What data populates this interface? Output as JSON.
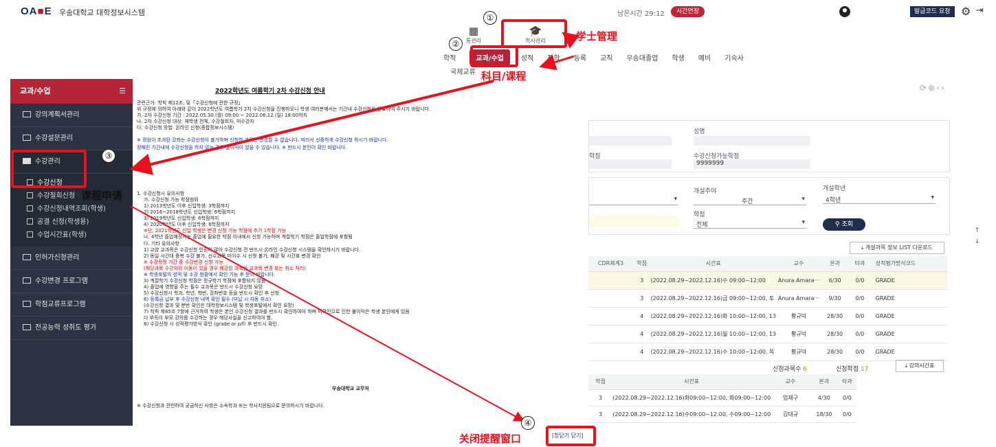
{
  "header": {
    "logo_a": "OA",
    "logo_b": "E",
    "system_name": "우송대학교 대학정보시스템",
    "remaining_time": "남은시간 29:12",
    "extend_label": "시간연장",
    "code_request_label": "발급코드 요청",
    "icons": [
      "user-icon",
      "gear-icon",
      "logout-icon"
    ]
  },
  "menu": {
    "icon_left_label": "통관리",
    "icon_active_label": "학사관리",
    "tabs": [
      "학적",
      "교과/수업",
      "성적",
      "장학",
      "등록",
      "교직",
      "우송대졸업",
      "학생",
      "예비",
      "기숙사"
    ],
    "active_tab": "교과/수업",
    "sub_tab": "국제교류"
  },
  "sidebar": {
    "title": "교과/수업",
    "items": [
      {
        "label": "강의계획서관리"
      },
      {
        "label": "수강설문관리"
      },
      {
        "label": "수강관리"
      },
      {
        "label": "인허가신청관리"
      },
      {
        "label": "수강변경 프로그램"
      },
      {
        "label": "학점교류프로그램"
      },
      {
        "label": "전공능력 성취도 평가"
      }
    ],
    "sub_items": [
      "수강신청",
      "수강철회신청",
      "수강신청내역조회(학생)",
      "공결 신청(학생용)",
      "수업시간표(학생)"
    ]
  },
  "notice": {
    "title": "2022학년도 여름학기 2차 수강신청 안내",
    "lines": [
      "관련근거: 학칙 제12조, 및「수강신청에 관한 규정」",
      "위 규정에 의하여 아래와 같이 2022학년도 여름학기 2차 수강신청을 진행하오니 학생 여러분께서는 기간내 수강신청을 완료하여 주시기 바랍니다.",
      "가. 2차 수강신청 기간 : 2022.05.30.(월) 09:00 ~ 2022.06.12.(일) 18:00까지",
      "나. 2차 수강신청 대상: 재학생 전체, 수강철회자, 미수강자",
      "다. 수강신청 방법: 온라인 신청(종합정보시스템)",
      "※ 정원이 초과된 강좌는 수강신청이 불가하며 신청한 과목은 변경할 수 없습니다. 따라서 신중하게 수강신청 하시기 바랍니다.",
      "정해진 기간내에 수강신청을 하지 않는 경우 불이익이 있을 수 있습니다. ※ 반드시 본인이 확인 바랍니다.",
      "1. 수강신청시 유의사항",
      "가. 수강신청 가능 학점범위",
      "1) 2013학년도 이후 신입학생: 3학점까지",
      "2) 2016~2018학년도 신입학생: 6학점까지",
      "3) 2019학년도 신입학생: 6학점까지",
      "4) 2020학년도 이후 신입학생: 6학점까지",
      "※단, 2021학년도 신입 학생은 변경 신청 가능 학점에 추가 1학점 가능",
      "나. 4학년 졸업예정자는 졸업에 필요한 학점 이내에서 신청 가능하며 계절학기 학점은 졸업학점에 포함됨",
      "다. 기타 유의사항",
      "1) 교양 교과목은 수강신청 인원이 많아 수강신청 전 반드시 온라인 수강신청 시스템을 확인하시기 바랍니다.",
      "2) 동일 시간대 중복 수강 불가, 선수과목 미이수 시 신청 불가, 폐강 및 시간표 변경 확인",
      "※ 수강정정 기간 중 수강변경 신청 가능",
      "(해당과목 수강자의 이동이 있을 경우 폐강된 과목은 교과목 변경 또는 취소 처리)",
      "※ 학생포털의 성적 및 수강 현황에서 확인 가능 후 문의 바랍니다.",
      "3) 계절학기 수강신청 학점은 정규학기 학점에 포함되지 않음",
      "4) 졸업에 영향을 주는 필수 교과목은 반드시 수강신청 요망",
      "5) 수강신청시 학과, 학년, 학번, 강좌번호 등을 반드시 확인 후 신청",
      "6) 등록금 납부 후 수강신청 내역 확인 필수 (미납 시 자동 취소)",
      "(수강신청 결과 및 분반 확인은 대학정보시스템 및 학생포털에서 확인 요망)",
      "7) 학칙 제85조 7항에 근거하여 학생은 본인 수강신청 결과를 반드시 확인하여야 하며 미확인으로 인한 불이익은 학생 본인에게 있음",
      "다 부득이 부모 강의를 수강하는 경우 해당사실을 신고하여야 함.",
      "8) 수강신청 시 성적평가방식 확인 (grade or p/f) 후 반드시 확인."
    ],
    "footer_org": "우송대학교 교무처",
    "footer_note": "※ 수강신청과 관련하여 궁금하신 사항은 소속학과 또는 학사지원팀으로 문의하시기 바랍니다.",
    "close_label": "[창닫기 닫기]"
  },
  "student_info": {
    "name_label": "성명",
    "credit_label": "학점",
    "avail_label": "수강신청가능학점",
    "avail_value": "9999999"
  },
  "filters": {
    "week_label": "개설주야",
    "week_value": "주간",
    "grade_label": "개설학년",
    "grade_value": "4학년",
    "credit_label": "학점",
    "credit_value": "전체",
    "search_label": "조회"
  },
  "course_table": {
    "download_label": "개설과목 정보 LIST 다운로드",
    "headers": [
      "CDR체계3",
      "학점",
      "시간표",
      "교수",
      "본과",
      "타과",
      "성적평가방식코드"
    ],
    "rows": [
      [
        "",
        "3",
        "(2022.08.29~2022.12.16)수 09:00~12:00",
        "Anura Amara···",
        "6/30",
        "0/0",
        "GRADE"
      ],
      [
        "",
        "3",
        "(2022.08.29~2022.12.16)금 09:00~12:00, 토",
        "Anura Amara···",
        "9/30",
        "0/0",
        "GRADE"
      ],
      [
        "",
        "4",
        "(2022.08.29~2022.12.16)화 10:00~12:00, 13",
        "황규덕",
        "28/30",
        "0/0",
        "GRADE"
      ],
      [
        "",
        "4",
        "(2022.08.29~2022.12.16)월 10:00~12:00, 13",
        "황규덕",
        "28/30",
        "0/0",
        "GRADE"
      ],
      [
        "",
        "4",
        "(2022.08.29~2022.12.16)수 10:00~12:00, 목",
        "황규덕",
        "28/30",
        "0/0",
        "GRADE"
      ]
    ]
  },
  "applied": {
    "count_label": "신청과목수",
    "count_value": "6",
    "credit_label": "신청학점",
    "credit_value": "17",
    "timetable_label": "강의시간표",
    "headers": [
      "학점",
      "시간표",
      "교수",
      "본과",
      "타과"
    ],
    "rows": [
      [
        "3",
        "(2022.08.29~2022.12.16)화09:00~12:00, 화09:00~12:00",
        "엄재구",
        "4/30",
        "0/0"
      ],
      [
        "3",
        "(2022.08.29~2022.12.16)수09:00~12:00, 수09:00~12:00",
        "김대규",
        "18/30",
        "0/0"
      ]
    ]
  },
  "annotations": {
    "n1": "①",
    "n2": "②",
    "n3": "③",
    "n4": "④",
    "label1": "学士管理",
    "label2": "科目/课程",
    "label3": "课程申请",
    "label4": "关闭提醒窗口",
    "color": "#e8121e"
  }
}
